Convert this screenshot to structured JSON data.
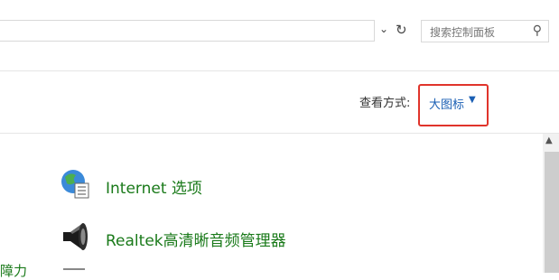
{
  "search": {
    "placeholder": "搜索控制面板"
  },
  "toolbar": {
    "view_by_label": "查看方式:",
    "view_by_value": "大图标"
  },
  "items": [
    {
      "label": "Internet 选项",
      "icon": "internet-options-icon"
    },
    {
      "label": "Realtek高清晰音频管理器",
      "icon": "speaker-icon"
    }
  ],
  "clipped_left_label": "障力",
  "colors": {
    "link_green": "#1a7a1a",
    "link_blue": "#1a5fb4",
    "highlight_red": "#e0342b"
  }
}
